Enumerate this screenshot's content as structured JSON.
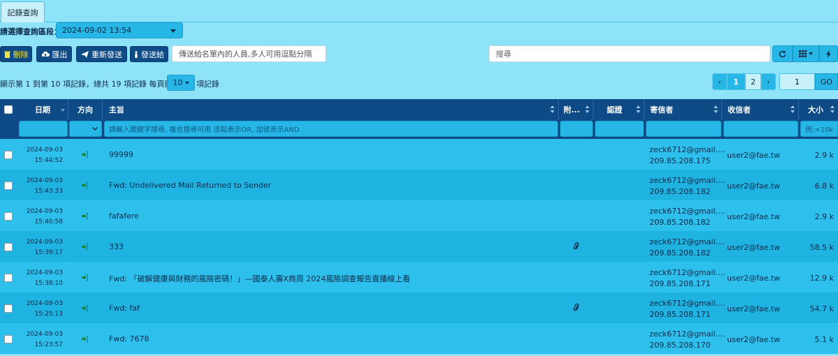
{
  "tab": {
    "label": "記錄查詢"
  },
  "period": {
    "label": "請選擇查詢區段：",
    "value": "2024-09-02 13:54"
  },
  "toolbar": {
    "delete_label": "刪除",
    "export_label": "匯出",
    "resend_label": "重新發送",
    "sendto_label": "發送給",
    "recipients_placeholder": "傳送給名單內的人員,多人可用逗點分隔",
    "search_placeholder": "搜尋"
  },
  "paging": {
    "info": "顯示第 1 到第 10 項記錄，總共 19 項記錄  每頁顯示",
    "per_page": "10",
    "info_suffix": "項記錄",
    "pages": [
      "1",
      "2"
    ],
    "goto_value": "1",
    "go_label": "GO"
  },
  "columns": {
    "date": "日期",
    "direction": "方向",
    "subject": "主旨",
    "attach": "附...",
    "auth": "認證",
    "sender": "寄信者",
    "recipient": "收信者",
    "size": "大小",
    "subject_filter_placeholder": "請輸入關鍵字搜尋, 複合搜尋可用 逗點表示OR,  加號表示AND",
    "size_filter_placeholder": "例:>10k"
  },
  "rows": [
    {
      "date": "2024-09-03",
      "time": "15:44:52",
      "subject": "99999",
      "attach": false,
      "sender": "zeck6712@gmail....",
      "ip": "209.85.208.175",
      "recipient": "user2@fae.tw",
      "size": "2.9 k"
    },
    {
      "date": "2024-09-03",
      "time": "15:43:33",
      "subject": "Fwd: Undelivered Mail Returned to Sender",
      "attach": false,
      "sender": "zeck6712@gmail....",
      "ip": "209.85.208.182",
      "recipient": "user2@fae.tw",
      "size": "6.8 k"
    },
    {
      "date": "2024-09-03",
      "time": "15:40:58",
      "subject": "fafafere",
      "attach": false,
      "sender": "zeck6712@gmail....",
      "ip": "209.85.208.182",
      "recipient": "user2@fae.tw",
      "size": "2.9 k"
    },
    {
      "date": "2024-09-03",
      "time": "15:39:17",
      "subject": "333",
      "attach": true,
      "sender": "zeck6712@gmail....",
      "ip": "209.85.208.182",
      "recipient": "user2@fae.tw",
      "size": "58.5 k"
    },
    {
      "date": "2024-09-03",
      "time": "15:38:10",
      "subject": "Fwd: 「破解健康與財務的風險密碼！」—國泰人壽X商周 2024風險調查報告直播線上看",
      "attach": false,
      "sender": "zeck6712@gmail....",
      "ip": "209.85.208.171",
      "recipient": "user2@fae.tw",
      "size": "12.9 k"
    },
    {
      "date": "2024-09-03",
      "time": "15:25:13",
      "subject": "Fwd: faf",
      "attach": true,
      "sender": "zeck6712@gmail....",
      "ip": "209.85.208.171",
      "recipient": "user2@fae.tw",
      "size": "54.7 k"
    },
    {
      "date": "2024-09-03",
      "time": "15:23:57",
      "subject": "Fwd: 7678",
      "attach": false,
      "sender": "zeck6712@gmail....",
      "ip": "209.85.208.170",
      "recipient": "user2@fae.tw",
      "size": "5.1 k"
    }
  ],
  "icons": {
    "delete": "trash-icon",
    "export": "cloud-upload-icon",
    "resend": "paper-plane-icon",
    "sendto": "person-icon",
    "refresh": "refresh-icon",
    "columns": "grid-icon",
    "toggle": "bolt-icon",
    "direction_in": "sign-in-icon",
    "attachment": "paperclip-icon"
  }
}
